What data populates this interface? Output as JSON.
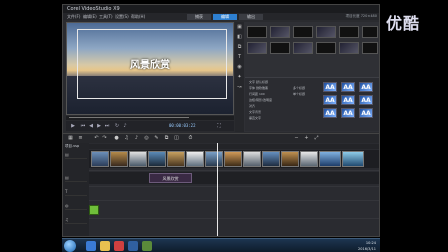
{
  "watermark": "优酷",
  "app": {
    "title": "Corel VideoStudio X9",
    "menu": [
      "文件(F)",
      "编辑(E)",
      "工具(T)",
      "设置(S)",
      "帮助(H)"
    ],
    "steps": [
      "捕获",
      "编辑",
      "输出"
    ],
    "active_step": "编辑",
    "project_size_label": "项目长度 720×480"
  },
  "preview": {
    "caption": "风景欣赏",
    "timecode": "00:00:03:22"
  },
  "library": {
    "options": [
      "文字 默认标题",
      "字体 微软雅黑",
      "行间距 100",
      "边框/阴影/透明度",
      "对齐",
      "文字背景",
      "垂直文字",
      "多个标题",
      "单个标题"
    ],
    "swatch_text": "AA"
  },
  "timeline": {
    "project_label": "项目.vsp",
    "title_clip_label": "风景欣赏"
  },
  "taskbar": {
    "time": "10:24",
    "date": "2016/3/11"
  },
  "colors": {
    "accent": "#2d7fd0",
    "title_clip": "#3a2a44",
    "green_clip": "#6fbf3a"
  }
}
